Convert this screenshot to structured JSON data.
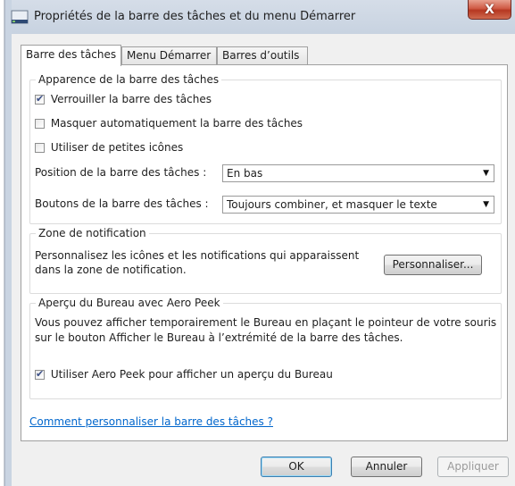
{
  "window": {
    "title": "Propriétés de la barre des tâches et du menu Démarrer",
    "close_label": "X"
  },
  "tabs": [
    {
      "label": "Barre des tâches",
      "active": true
    },
    {
      "label": "Menu Démarrer",
      "active": false
    },
    {
      "label": "Barres d’outils",
      "active": false
    }
  ],
  "appearance": {
    "legend": "Apparence de la barre des tâches",
    "lock_label": "Verrouiller la barre des tâches",
    "lock_checked": true,
    "autohide_label": "Masquer automatiquement la barre des tâches",
    "autohide_checked": false,
    "small_icons_label": "Utiliser de petites icônes",
    "small_icons_checked": false,
    "position_label": "Position de la barre des tâches :",
    "position_value": "En bas",
    "buttons_label": "Boutons de la barre des tâches :",
    "buttons_value": "Toujours combiner, et masquer le texte"
  },
  "notification": {
    "legend": "Zone de notification",
    "description_line1": "Personnalisez les icônes et les notifications qui apparaissent",
    "description_line2": "dans la zone de notification.",
    "customize_label": "Personnaliser..."
  },
  "peek": {
    "legend": "Aperçu du Bureau avec Aero Peek",
    "description_line1": "Vous pouvez afficher temporairement le Bureau en plaçant le pointeur de votre souris",
    "description_line2": "sur le bouton Afficher le Bureau à l’extrémité de la barre des tâches.",
    "use_peek_label": "Utiliser Aero Peek pour afficher un aperçu du Bureau",
    "use_peek_checked": true
  },
  "help_link": "Comment personnaliser la barre des tâches ?",
  "footer": {
    "ok_label": "OK",
    "cancel_label": "Annuler",
    "apply_label": "Appliquer",
    "apply_enabled": false
  }
}
